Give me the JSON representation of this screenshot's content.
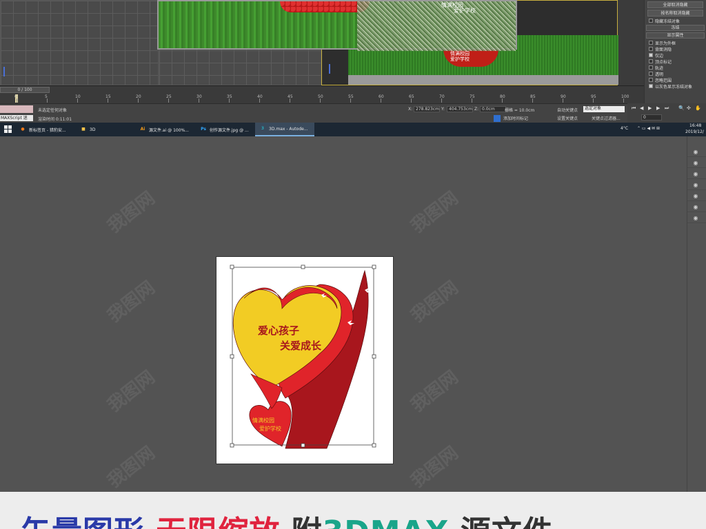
{
  "max": {
    "render_text_1": "情满校园",
    "render_text_2": "爱护学校",
    "persp_text_1": "情满校园",
    "persp_text_2": "爱护学校",
    "time_slider": "0 / 100",
    "ruler_ticks": [
      "0",
      "5",
      "10",
      "15",
      "20",
      "25",
      "30",
      "35",
      "40",
      "45",
      "50",
      "55",
      "60",
      "65",
      "70",
      "75",
      "80",
      "85",
      "90",
      "95",
      "100"
    ],
    "status_msg": "未选定任何对象",
    "status_time": "渲染时间 0:11:01",
    "script_label": "MAXScript 迷",
    "x_label": "X:",
    "x_value": "278.823cm",
    "y_label": "Y:",
    "y_value": "404.753cm",
    "z_label": "Z:",
    "z_value": "0.0cm",
    "grid_label": "栅格 = 10.0cm",
    "auto_key": "自动关键点",
    "set_key": "设置关键点",
    "selected_obj": "选定对象",
    "key_filter": "关键点过滤器...",
    "add_time_tag": "添加时间标记",
    "frame_value": "0",
    "cmd_panel": {
      "btn_unhide_all": "全部取消隐藏",
      "btn_unhide_by_name": "按名称取消隐藏",
      "hide_frozen": "隐藏冻结对象",
      "sec_freeze": "冻结",
      "sec_display_props": "显示属性",
      "rows": [
        {
          "label": "显示为外框",
          "on": false
        },
        {
          "label": "背面消隐",
          "on": false
        },
        {
          "label": "仅边",
          "on": true
        },
        {
          "label": "顶点标记",
          "on": false
        },
        {
          "label": "轨迹",
          "on": false
        },
        {
          "label": "透明",
          "on": false
        },
        {
          "label": "忽略范围",
          "on": false
        },
        {
          "label": "以灰色显示冻结对象",
          "on": true
        }
      ]
    }
  },
  "taskbar": {
    "items": [
      {
        "label": "新标签页 - 猎豹安...",
        "icon": "browser-icon",
        "color": "#f07a1a"
      },
      {
        "label": "3D",
        "icon": "folder-icon",
        "color": "#f2c14a"
      },
      {
        "label": "源文件.ai @ 100%...",
        "icon": "illustrator-icon",
        "color": "#f29a1a"
      },
      {
        "label": "创作源文件.jpg @ ...",
        "icon": "photoshop-icon",
        "color": "#31a8ff"
      },
      {
        "label": "3D.max - Autode...",
        "icon": "3dsmax-icon",
        "color": "#29a8b8"
      }
    ],
    "temp": "4°C",
    "time": "16:48",
    "date": "2019/12/"
  },
  "artwork": {
    "title_line1": "爱心孩子",
    "title_line2": "关爱成长",
    "small_line1": "情满校园",
    "small_line2": "爱护学校",
    "colors": {
      "yellow": "#f2cc24",
      "red": "#e0242a",
      "darkred": "#a8161d",
      "text": "#a8161d"
    }
  },
  "watermark": "我图网",
  "banner": {
    "part1": "矢量图形",
    "part2": "无限缩放",
    "part3": "附",
    "part4": "3DMAX",
    "part5": "源文件"
  }
}
